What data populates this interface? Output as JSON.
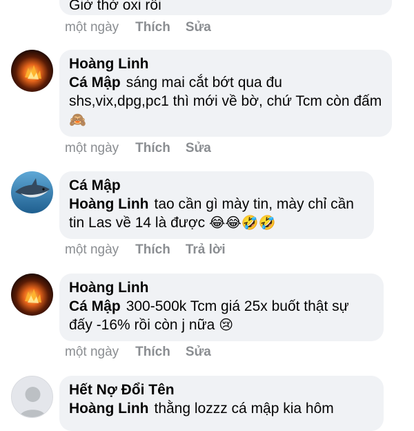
{
  "comments": [
    {
      "author": "",
      "mention": "",
      "text": "Giờ thở oxi rồi",
      "time": "một ngày",
      "like": "Thích",
      "action2": "Sửa",
      "emoji": ""
    },
    {
      "author": "Hoàng Linh",
      "mention": "Cá Mập",
      "text": "sáng mai cắt bớt qua đu shs,vix,dpg,pc1 thì mới về bờ, chứ Tcm còn đấm",
      "emoji": "🙈",
      "time": "một ngày",
      "like": "Thích",
      "action2": "Sửa",
      "avatar_icon": "fire-avatar-icon"
    },
    {
      "author": "Cá Mập",
      "mention": "Hoàng Linh",
      "text": "tao cần  gì mày tin, mày chỉ cần tin Las về 14 là được",
      "emoji": "😂😂🤣🤣",
      "time": "một ngày",
      "like": "Thích",
      "action2": "Trả lời",
      "avatar_icon": "shark-avatar-icon"
    },
    {
      "author": "Hoàng Linh",
      "mention": "Cá Mập",
      "text": "300-500k Tcm giá 25x buốt thật sự đấy -16% rồi còn j nữa",
      "emoji": "😢",
      "time": "một ngày",
      "like": "Thích",
      "action2": "Sửa",
      "avatar_icon": "fire-avatar-icon"
    },
    {
      "author": "Hết Nợ Đổi Tên",
      "mention": "Hoàng Linh",
      "text": "thằng lozzz cá mập kia hôm",
      "emoji": "",
      "avatar_icon": "default-user-avatar-icon"
    }
  ],
  "colors": {
    "bubble": "#f0f2f5",
    "meta": "#8a8d91",
    "text": "#050505"
  }
}
